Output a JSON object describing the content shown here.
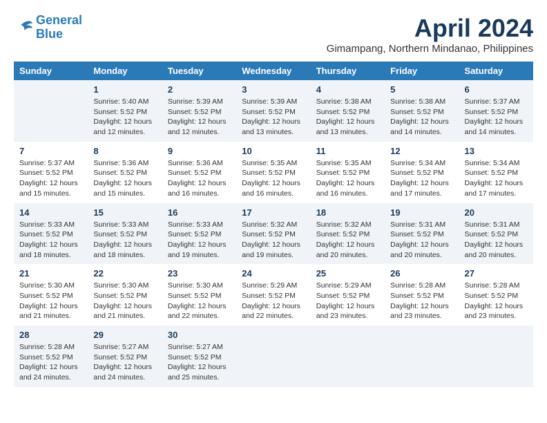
{
  "logo": {
    "line1": "General",
    "line2": "Blue"
  },
  "title": "April 2024",
  "subtitle": "Gimampang, Northern Mindanao, Philippines",
  "columns": [
    "Sunday",
    "Monday",
    "Tuesday",
    "Wednesday",
    "Thursday",
    "Friday",
    "Saturday"
  ],
  "weeks": [
    [
      {
        "day": "",
        "info": ""
      },
      {
        "day": "1",
        "info": "Sunrise: 5:40 AM\nSunset: 5:52 PM\nDaylight: 12 hours\nand 12 minutes."
      },
      {
        "day": "2",
        "info": "Sunrise: 5:39 AM\nSunset: 5:52 PM\nDaylight: 12 hours\nand 12 minutes."
      },
      {
        "day": "3",
        "info": "Sunrise: 5:39 AM\nSunset: 5:52 PM\nDaylight: 12 hours\nand 13 minutes."
      },
      {
        "day": "4",
        "info": "Sunrise: 5:38 AM\nSunset: 5:52 PM\nDaylight: 12 hours\nand 13 minutes."
      },
      {
        "day": "5",
        "info": "Sunrise: 5:38 AM\nSunset: 5:52 PM\nDaylight: 12 hours\nand 14 minutes."
      },
      {
        "day": "6",
        "info": "Sunrise: 5:37 AM\nSunset: 5:52 PM\nDaylight: 12 hours\nand 14 minutes."
      }
    ],
    [
      {
        "day": "7",
        "info": "Sunrise: 5:37 AM\nSunset: 5:52 PM\nDaylight: 12 hours\nand 15 minutes."
      },
      {
        "day": "8",
        "info": "Sunrise: 5:36 AM\nSunset: 5:52 PM\nDaylight: 12 hours\nand 15 minutes."
      },
      {
        "day": "9",
        "info": "Sunrise: 5:36 AM\nSunset: 5:52 PM\nDaylight: 12 hours\nand 16 minutes."
      },
      {
        "day": "10",
        "info": "Sunrise: 5:35 AM\nSunset: 5:52 PM\nDaylight: 12 hours\nand 16 minutes."
      },
      {
        "day": "11",
        "info": "Sunrise: 5:35 AM\nSunset: 5:52 PM\nDaylight: 12 hours\nand 16 minutes."
      },
      {
        "day": "12",
        "info": "Sunrise: 5:34 AM\nSunset: 5:52 PM\nDaylight: 12 hours\nand 17 minutes."
      },
      {
        "day": "13",
        "info": "Sunrise: 5:34 AM\nSunset: 5:52 PM\nDaylight: 12 hours\nand 17 minutes."
      }
    ],
    [
      {
        "day": "14",
        "info": "Sunrise: 5:33 AM\nSunset: 5:52 PM\nDaylight: 12 hours\nand 18 minutes."
      },
      {
        "day": "15",
        "info": "Sunrise: 5:33 AM\nSunset: 5:52 PM\nDaylight: 12 hours\nand 18 minutes."
      },
      {
        "day": "16",
        "info": "Sunrise: 5:33 AM\nSunset: 5:52 PM\nDaylight: 12 hours\nand 19 minutes."
      },
      {
        "day": "17",
        "info": "Sunrise: 5:32 AM\nSunset: 5:52 PM\nDaylight: 12 hours\nand 19 minutes."
      },
      {
        "day": "18",
        "info": "Sunrise: 5:32 AM\nSunset: 5:52 PM\nDaylight: 12 hours\nand 20 minutes."
      },
      {
        "day": "19",
        "info": "Sunrise: 5:31 AM\nSunset: 5:52 PM\nDaylight: 12 hours\nand 20 minutes."
      },
      {
        "day": "20",
        "info": "Sunrise: 5:31 AM\nSunset: 5:52 PM\nDaylight: 12 hours\nand 20 minutes."
      }
    ],
    [
      {
        "day": "21",
        "info": "Sunrise: 5:30 AM\nSunset: 5:52 PM\nDaylight: 12 hours\nand 21 minutes."
      },
      {
        "day": "22",
        "info": "Sunrise: 5:30 AM\nSunset: 5:52 PM\nDaylight: 12 hours\nand 21 minutes."
      },
      {
        "day": "23",
        "info": "Sunrise: 5:30 AM\nSunset: 5:52 PM\nDaylight: 12 hours\nand 22 minutes."
      },
      {
        "day": "24",
        "info": "Sunrise: 5:29 AM\nSunset: 5:52 PM\nDaylight: 12 hours\nand 22 minutes."
      },
      {
        "day": "25",
        "info": "Sunrise: 5:29 AM\nSunset: 5:52 PM\nDaylight: 12 hours\nand 23 minutes."
      },
      {
        "day": "26",
        "info": "Sunrise: 5:28 AM\nSunset: 5:52 PM\nDaylight: 12 hours\nand 23 minutes."
      },
      {
        "day": "27",
        "info": "Sunrise: 5:28 AM\nSunset: 5:52 PM\nDaylight: 12 hours\nand 23 minutes."
      }
    ],
    [
      {
        "day": "28",
        "info": "Sunrise: 5:28 AM\nSunset: 5:52 PM\nDaylight: 12 hours\nand 24 minutes."
      },
      {
        "day": "29",
        "info": "Sunrise: 5:27 AM\nSunset: 5:52 PM\nDaylight: 12 hours\nand 24 minutes."
      },
      {
        "day": "30",
        "info": "Sunrise: 5:27 AM\nSunset: 5:52 PM\nDaylight: 12 hours\nand 25 minutes."
      },
      {
        "day": "",
        "info": ""
      },
      {
        "day": "",
        "info": ""
      },
      {
        "day": "",
        "info": ""
      },
      {
        "day": "",
        "info": ""
      }
    ]
  ]
}
